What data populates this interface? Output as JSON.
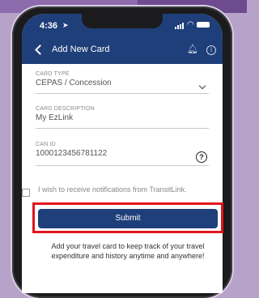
{
  "status_bar": {
    "time": "4:36"
  },
  "nav": {
    "title": "Add New Card"
  },
  "form": {
    "card_type": {
      "label": "CARD TYPE",
      "value": "CEPAS / Concession"
    },
    "card_description": {
      "label": "CARD DESCRIPTION",
      "value": "My EzLink"
    },
    "can_id": {
      "label": "CAN ID",
      "value": "1000123456781122",
      "help_glyph": "?"
    },
    "notifications": {
      "label": "I wish to receive notifications from TransitLink.",
      "checked": false
    }
  },
  "submit": {
    "label": "Submit"
  },
  "footer": {
    "text": "Add your travel card to keep track of your travel expenditure and history anytime and anywhere!"
  },
  "colors": {
    "header": "#1f3f7a",
    "highlight": "#e0151c",
    "frame_bg": "#b7a2c9"
  }
}
